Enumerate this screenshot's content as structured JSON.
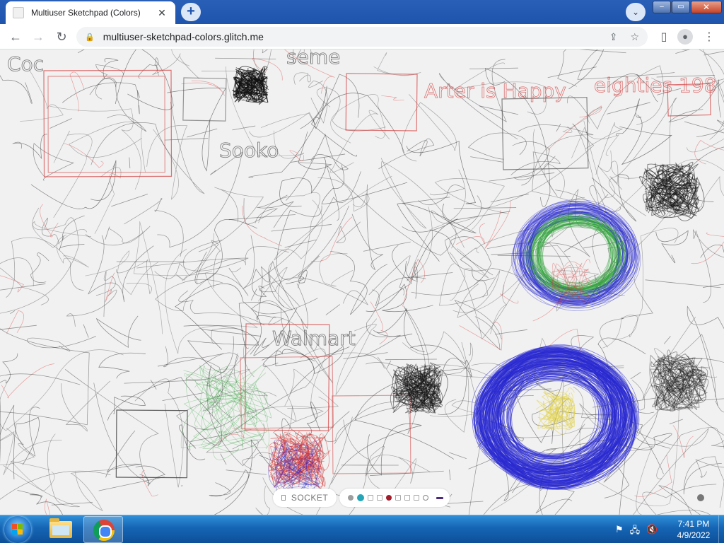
{
  "browser": {
    "tab": {
      "title": "Multiuser Sketchpad (Colors)",
      "close_glyph": "✕",
      "favicon": "page-icon"
    },
    "new_tab_glyph": "+",
    "tab_search_glyph": "⌄",
    "window_controls": {
      "minimize": "–",
      "maximize": "▭",
      "close": "✕"
    },
    "toolbar": {
      "back_glyph": "←",
      "forward_glyph": "→",
      "reload_glyph": "↻",
      "lock_glyph": "🔒",
      "url": "multiuser-sketchpad-colors.glitch.me",
      "share_glyph": "⇪",
      "star_glyph": "☆",
      "side_panel_glyph": "▯",
      "profile_glyph": "●",
      "menu_glyph": "⋮"
    }
  },
  "sketchpad": {
    "socket_label": "SOCKET",
    "palette": [
      {
        "name": "gray",
        "color": "#9e9e9e",
        "shape": "dot"
      },
      {
        "name": "teal",
        "color": "#26a4b8",
        "shape": "dot",
        "selected": true
      },
      {
        "name": "white",
        "color": "#ffffff",
        "shape": "square"
      },
      {
        "name": "white",
        "color": "#ffffff",
        "shape": "square"
      },
      {
        "name": "dark-red",
        "color": "#a11d2b",
        "shape": "dot"
      },
      {
        "name": "white",
        "color": "#ffffff",
        "shape": "square"
      },
      {
        "name": "white",
        "color": "#ffffff",
        "shape": "square"
      },
      {
        "name": "white",
        "color": "#ffffff",
        "shape": "square"
      },
      {
        "name": "white",
        "color": "#ffffff",
        "shape": "ring"
      }
    ],
    "pen_color": "#4b2a7a",
    "stroke_colors": {
      "pencil": "#3a3a3a",
      "red": "#d63a3a",
      "blue": "#2a2ad2",
      "green": "#2fa23a",
      "yellow": "#e0d040"
    }
  },
  "taskbar": {
    "time": "7:41 PM",
    "date": "4/9/2022",
    "tray_icons": [
      "flag-icon",
      "network-icon",
      "volume-muted-icon"
    ],
    "tray_glyphs": [
      "⚑",
      "🖧",
      "🔇"
    ]
  }
}
